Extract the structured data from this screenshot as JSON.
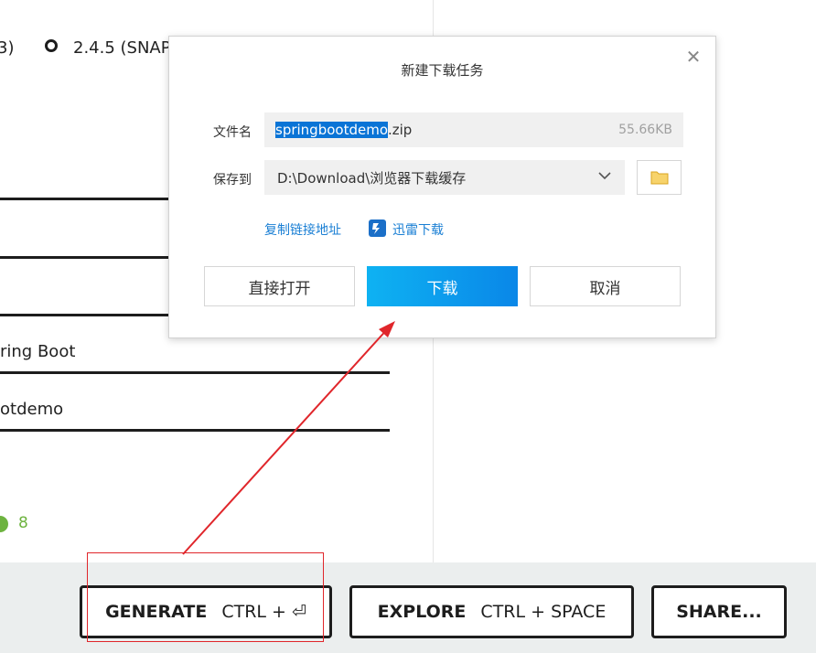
{
  "background": {
    "version_partial": "3)",
    "version_option": "2.4.5 (SNAP",
    "field_spring_boot": "ring Boot",
    "field_artifact": "otdemo",
    "dependency_count": "8"
  },
  "footer": {
    "generate": {
      "label": "GENERATE",
      "shortcut": "CTRL + ⏎"
    },
    "explore": {
      "label": "EXPLORE",
      "shortcut": "CTRL + SPACE"
    },
    "share": {
      "label": "SHARE..."
    }
  },
  "dialog": {
    "title": "新建下载任务",
    "close_symbol": "✕",
    "filename_label": "文件名",
    "filename_selected": "springbootdemo",
    "filename_ext": ".zip",
    "file_size": "55.66KB",
    "saveto_label": "保存到",
    "save_path": "D:\\Download\\浏览器下载缓存",
    "copy_link": "复制链接地址",
    "thunder_download": "迅雷下载",
    "btn_open": "直接打开",
    "btn_download": "下载",
    "btn_cancel": "取消"
  },
  "colors": {
    "accent_blue": "#0a87e8",
    "link_blue": "#1a7fd4",
    "annotation_red": "#e0262b",
    "spring_green": "#6db33f"
  },
  "icons": [
    "close-icon",
    "chevron-down-icon",
    "folder-icon",
    "thunder-icon",
    "radio-icon"
  ]
}
